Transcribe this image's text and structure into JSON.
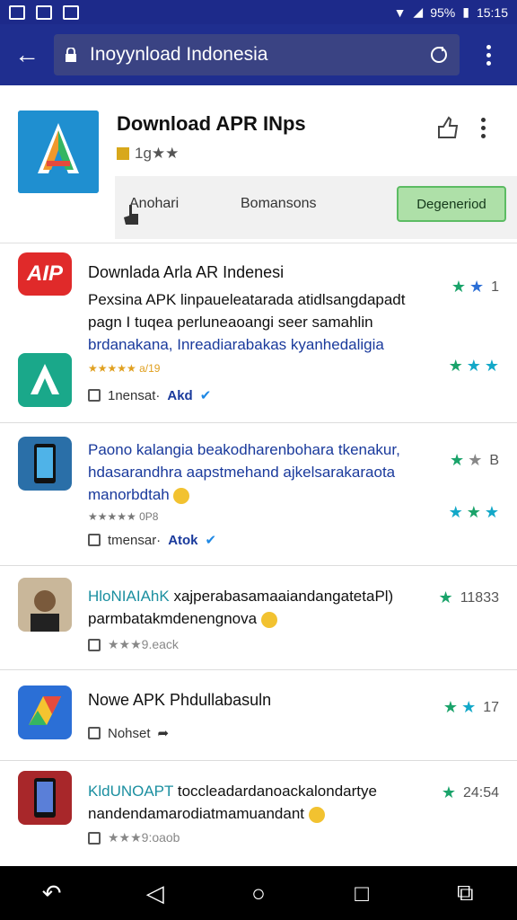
{
  "status_bar": {
    "battery": "95%",
    "time": "15:15"
  },
  "browser": {
    "url_text": "Inoyynload Indonesia"
  },
  "hero": {
    "title": "Download APR INps",
    "rating": "1g★★",
    "tabs": [
      "Anohari",
      "Bomansons"
    ],
    "action": "Degeneriod"
  },
  "items": [
    {
      "title": "Downlada Arla AR Indenesi",
      "desc1": "Pexsina APK linpaueleatarada atidlsangdapadt pagn I tuqea perluneaoangi seer samahlin",
      "desc2": "brdanakana, Inreadiarabakas kyanhedaligia",
      "sub": "★★★★★ a/19",
      "meta_label": "1nensat·",
      "meta_link": "Akd",
      "rating1": "1",
      "icon_a_label": "AIP"
    },
    {
      "title": "Paono kalangia beakodharenbohara tkenakur, hdasarandhra aapstmehand ajkelsarakaraota",
      "title_last": "manorbdtah",
      "sub": "★★★★★ 0P8",
      "meta_label": "tmensar·",
      "meta_link": "Atok",
      "rating1": "B"
    },
    {
      "title_teal": "HloNIAIAhK",
      "title_rest": "xajperabasamaaiandangatetaPl) parmbatakmdenengnova",
      "meta_mini": "★★★9.eack",
      "rating1": "11833"
    },
    {
      "title": "Nowe APK Phdullabasuln",
      "meta_label": "Nohset",
      "rating1": "17"
    },
    {
      "title_teal": "KldUNOAPT",
      "title_rest": "toccleadardanoackalondartye nandendamarodiatmamuandant",
      "meta_mini": "★★★9:oaob",
      "rating1": "24:54"
    }
  ]
}
